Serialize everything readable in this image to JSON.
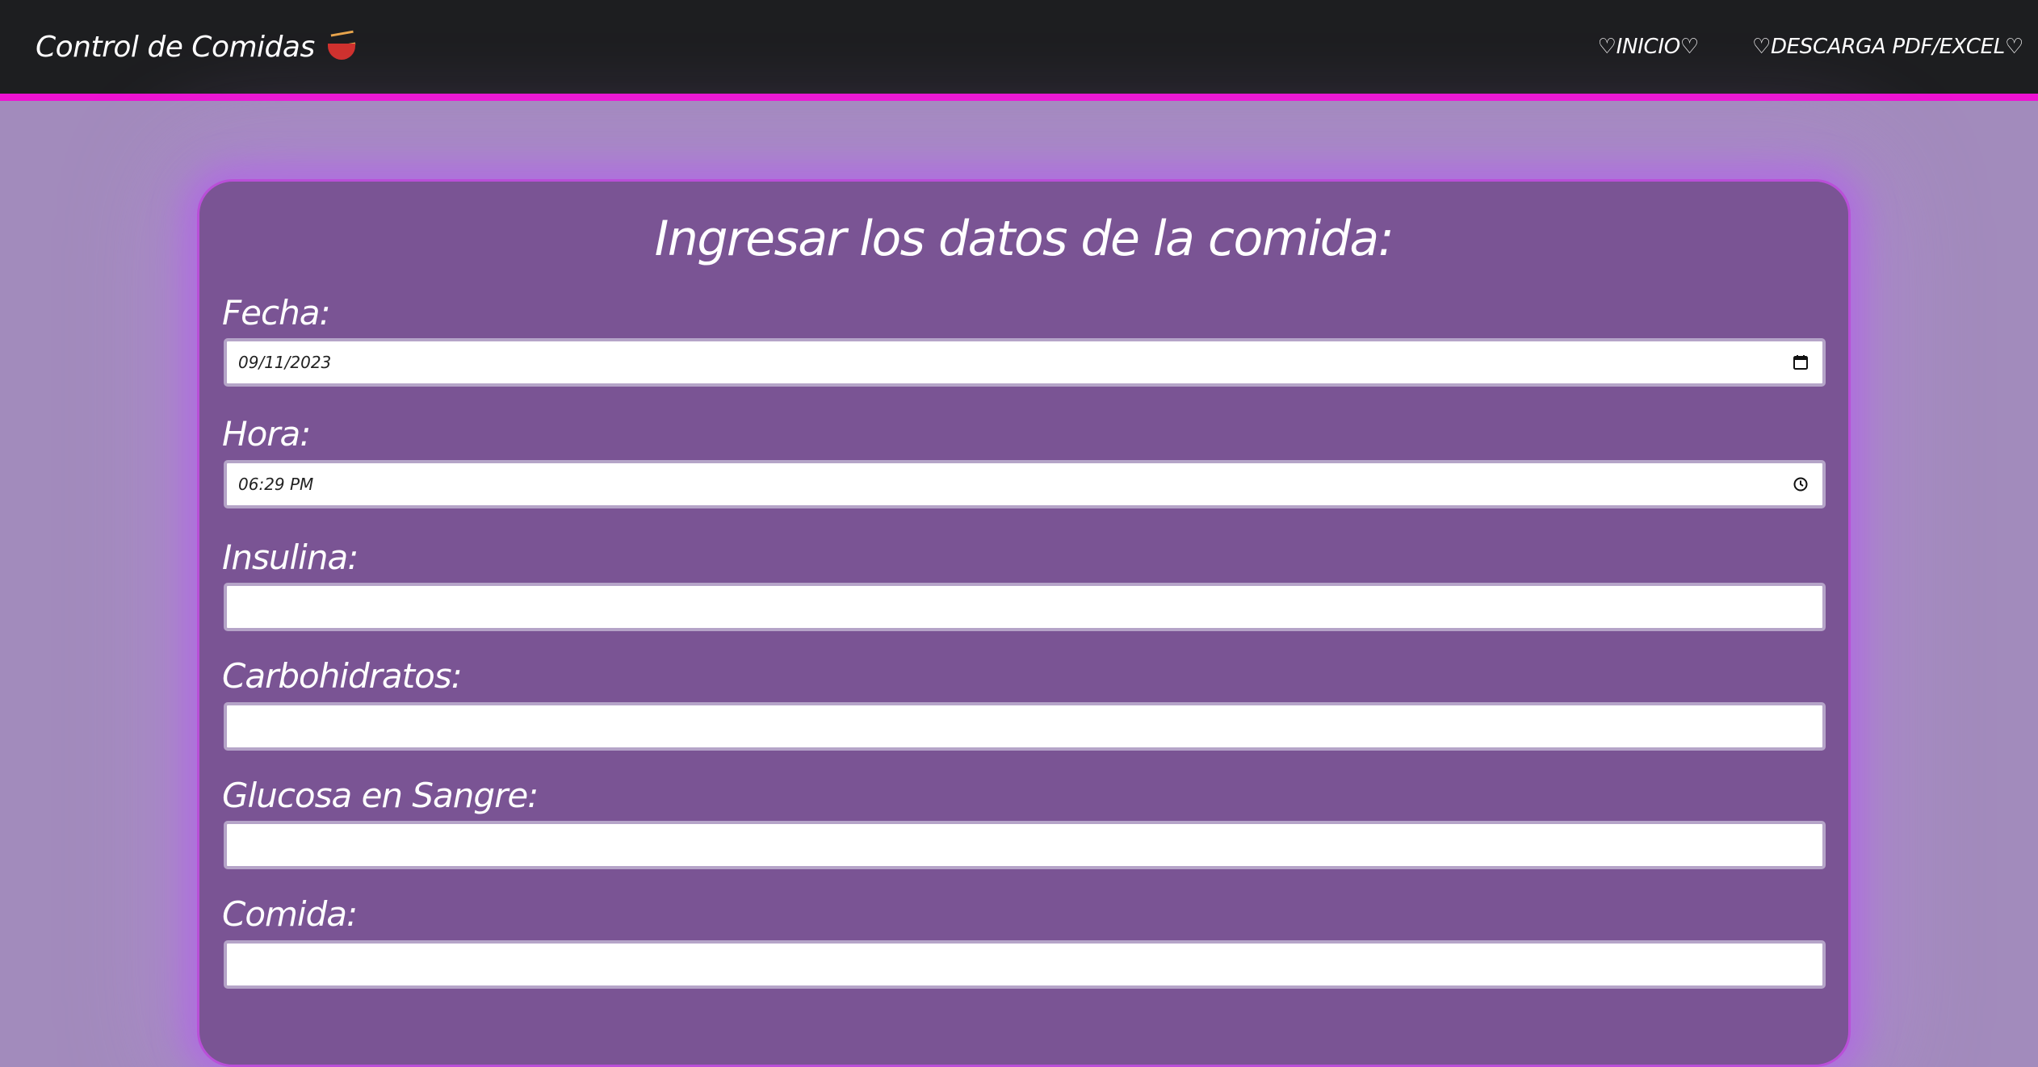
{
  "navbar": {
    "brand": "Control de Comidas",
    "brand_icon": "noodle-bowl-icon",
    "links": [
      {
        "label": "♡INICIO♡"
      },
      {
        "label": "♡DESCARGA PDF/EXCEL♡"
      }
    ],
    "accent_color": "#ee12d2"
  },
  "form": {
    "title": "Ingresar los datos de la comida:",
    "fields": [
      {
        "label": "Fecha:",
        "value": "09/11/2023",
        "icon": "calendar-icon"
      },
      {
        "label": "Hora:",
        "value": "06:29 PM",
        "icon": "clock-icon"
      },
      {
        "label": "Insulina:",
        "value": ""
      },
      {
        "label": "Carbohidratos:",
        "value": ""
      },
      {
        "label": "Glucosa en Sangre:",
        "value": ""
      },
      {
        "label": "Comida:",
        "value": ""
      }
    ]
  },
  "colors": {
    "page_background": "#a28bbc",
    "card_background": "#7a5494",
    "navbar_background": "#1d1e20"
  }
}
